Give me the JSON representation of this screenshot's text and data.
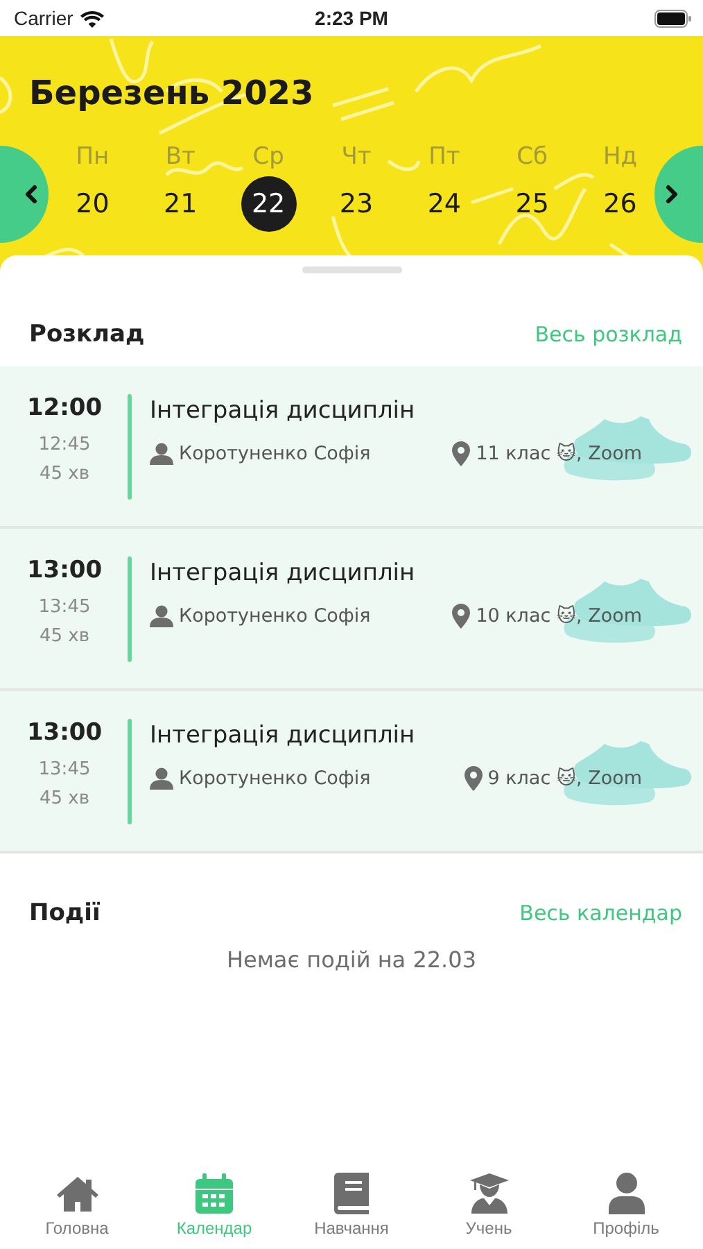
{
  "status_bar": {
    "carrier": "Carrier",
    "time": "2:23 PM"
  },
  "header": {
    "month": "Березень 2023",
    "days": [
      {
        "weekday": "Пн",
        "date": "20",
        "selected": false
      },
      {
        "weekday": "Вт",
        "date": "21",
        "selected": false
      },
      {
        "weekday": "Ср",
        "date": "22",
        "selected": true
      },
      {
        "weekday": "Чт",
        "date": "23",
        "selected": false
      },
      {
        "weekday": "Пт",
        "date": "24",
        "selected": false
      },
      {
        "weekday": "Сб",
        "date": "25",
        "selected": false
      },
      {
        "weekday": "Нд",
        "date": "26",
        "selected": false
      }
    ]
  },
  "schedule": {
    "title": "Розклад",
    "link": "Весь розклад",
    "lessons": [
      {
        "start": "12:00",
        "end": "12:45",
        "duration": "45 хв",
        "subject": "Інтеграція дисциплін",
        "teacher": "Коротуненко Софія",
        "place": "11 клас 🐱, Zoom"
      },
      {
        "start": "13:00",
        "end": "13:45",
        "duration": "45 хв",
        "subject": "Інтеграція дисциплін",
        "teacher": "Коротуненко Софія",
        "place": "10 клас 🐱, Zoom"
      },
      {
        "start": "13:00",
        "end": "13:45",
        "duration": "45 хв",
        "subject": "Інтеграція дисциплін",
        "teacher": "Коротуненко Софія",
        "place": "9 клас 🐱, Zoom"
      }
    ]
  },
  "events": {
    "title": "Події",
    "link": "Весь календар",
    "empty": "Немає подій на 22.03"
  },
  "tabs": [
    {
      "kind": "home",
      "label": "Головна",
      "selected": false
    },
    {
      "kind": "calendar",
      "label": "Календар",
      "selected": true
    },
    {
      "kind": "book",
      "label": "Навчання",
      "selected": false
    },
    {
      "kind": "student",
      "label": "Учень",
      "selected": false
    },
    {
      "kind": "profile",
      "label": "Профіль",
      "selected": false
    }
  ]
}
